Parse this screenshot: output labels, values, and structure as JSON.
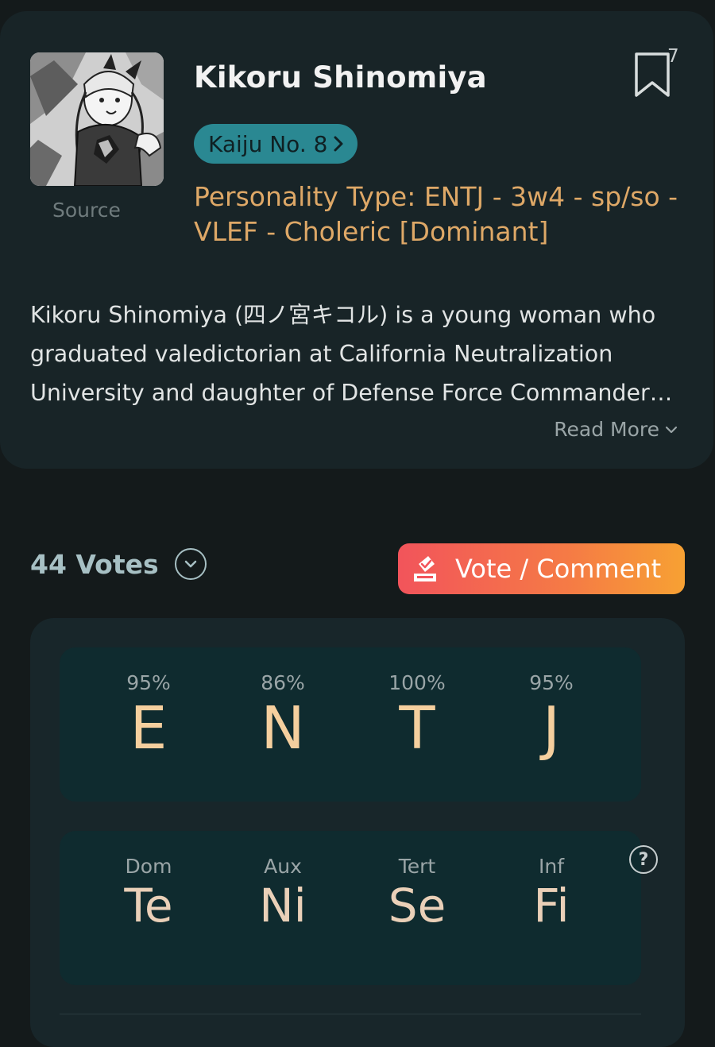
{
  "profile": {
    "name": "Kikoru Shinomiya",
    "source_label": "Source",
    "bookmark_count": "7",
    "series_label": "Kaiju No. 8",
    "personality": "Personality Type: ENTJ - 3w4 - sp/so - VLEF - Choleric [Dominant]",
    "description": "Kikoru Shinomiya (四ノ宮キコル) is a young woman who graduated valedictorian at California Neutralization University and daughter of Defense Force Commander Isao Shinomiya.",
    "read_more_label": "Read More"
  },
  "votes": {
    "count_label": "44 Votes",
    "vote_button_label": "Vote / Comment"
  },
  "type_letters": [
    {
      "percent": "95%",
      "letter": "E"
    },
    {
      "percent": "86%",
      "letter": "N"
    },
    {
      "percent": "100%",
      "letter": "T"
    },
    {
      "percent": "95%",
      "letter": "J"
    }
  ],
  "functions": [
    {
      "position": "Dom",
      "function": "Te"
    },
    {
      "position": "Aux",
      "function": "Ni"
    },
    {
      "position": "Tert",
      "function": "Se"
    },
    {
      "position": "Inf",
      "function": "Fi"
    }
  ],
  "help_glyph": "?",
  "colors": {
    "background": "#141a1b",
    "card": "#182427",
    "accent_teal": "#2a8892",
    "personality_gold": "#dea867",
    "letter_color": "#f5cf9e",
    "vote_gradient_start": "#f2545b",
    "vote_gradient_end": "#f7a133"
  },
  "icons": {
    "bookmark": "bookmark-icon",
    "series_chevron": "chevron-right-icon",
    "read_more_chevron": "chevron-down-icon",
    "votes_toggle": "chevron-down-circle-icon",
    "vote": "ballot-icon",
    "help": "question-circle-icon"
  }
}
